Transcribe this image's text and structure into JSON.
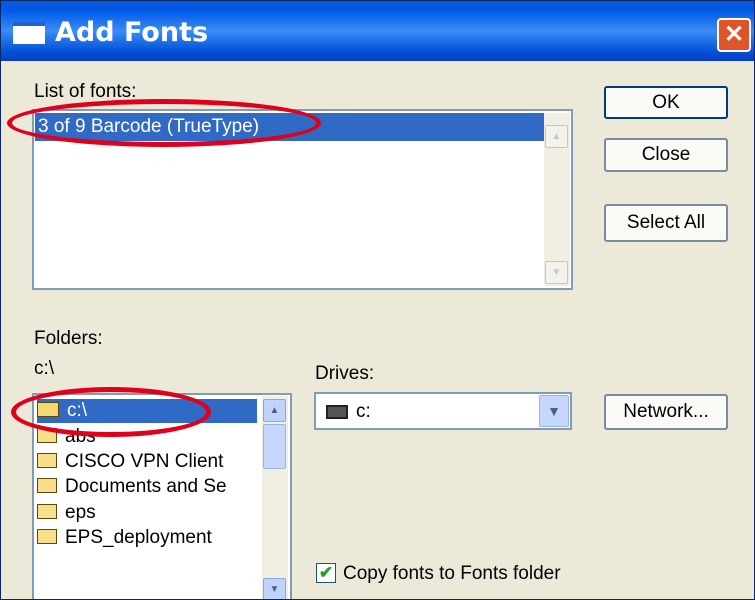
{
  "window": {
    "title": "Add Fonts",
    "close_glyph": "✕"
  },
  "fonts": {
    "label": "List of fonts:",
    "items": [
      "3 of 9 Barcode (TrueType)"
    ]
  },
  "buttons": {
    "ok": "OK",
    "close": "Close",
    "select_all": "Select All",
    "network": "Network..."
  },
  "folders": {
    "label": "Folders:",
    "current_path": "c:\\",
    "items": [
      "c:\\",
      "abs",
      "CISCO VPN Client",
      "Documents and Se",
      "eps",
      "EPS_deployment"
    ]
  },
  "drives": {
    "label": "Drives:",
    "selected": "c:"
  },
  "copy_option": {
    "label": "Copy fonts to Fonts folder",
    "checked": true
  },
  "icons": {
    "up_arrow": "▲",
    "down_arrow": "▼",
    "checkmark": "✔",
    "window_icon": "window-icon",
    "folder_icon": "folder-icon",
    "open_folder_icon": "open-folder-icon",
    "drive_icon": "hard-drive-icon"
  },
  "colors": {
    "titlebar": "#0058e6",
    "selection": "#316ac5",
    "annotation": "#e0001b",
    "dialog_bg": "#ece9d8",
    "close_button": "#e0542c"
  }
}
